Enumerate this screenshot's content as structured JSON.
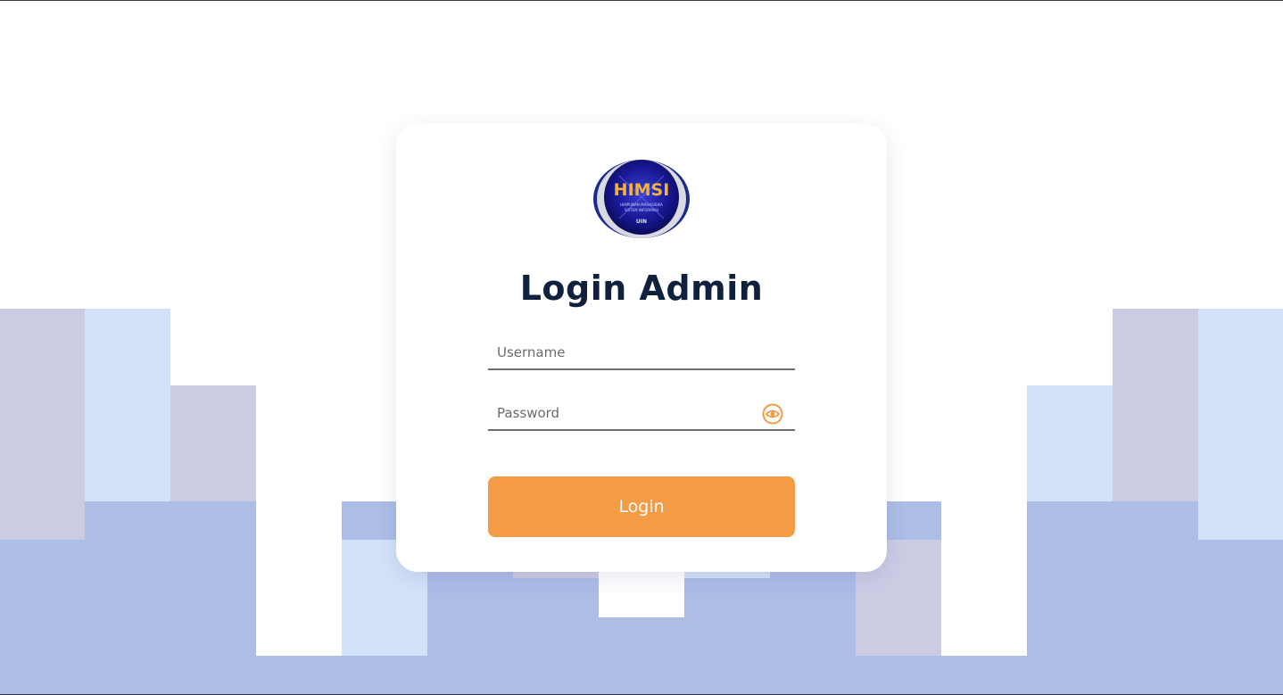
{
  "login": {
    "logo_text": "HIMSI",
    "logo_subtext_1": "HIMPUNAN MAHASISWA",
    "logo_subtext_2": "SISTEM INFORMASI",
    "logo_badge": "UIN",
    "title": "Login Admin",
    "username": {
      "placeholder": "Username",
      "value": ""
    },
    "password": {
      "placeholder": "Password",
      "value": "",
      "toggle_icon": "eye-icon"
    },
    "button_label": "Login"
  },
  "colors": {
    "accent": "#f39c45",
    "title": "#0f213d",
    "background_lavender": "#cbcce4",
    "background_sky": "#d2e2f8",
    "background_mid": "#acbde6"
  }
}
